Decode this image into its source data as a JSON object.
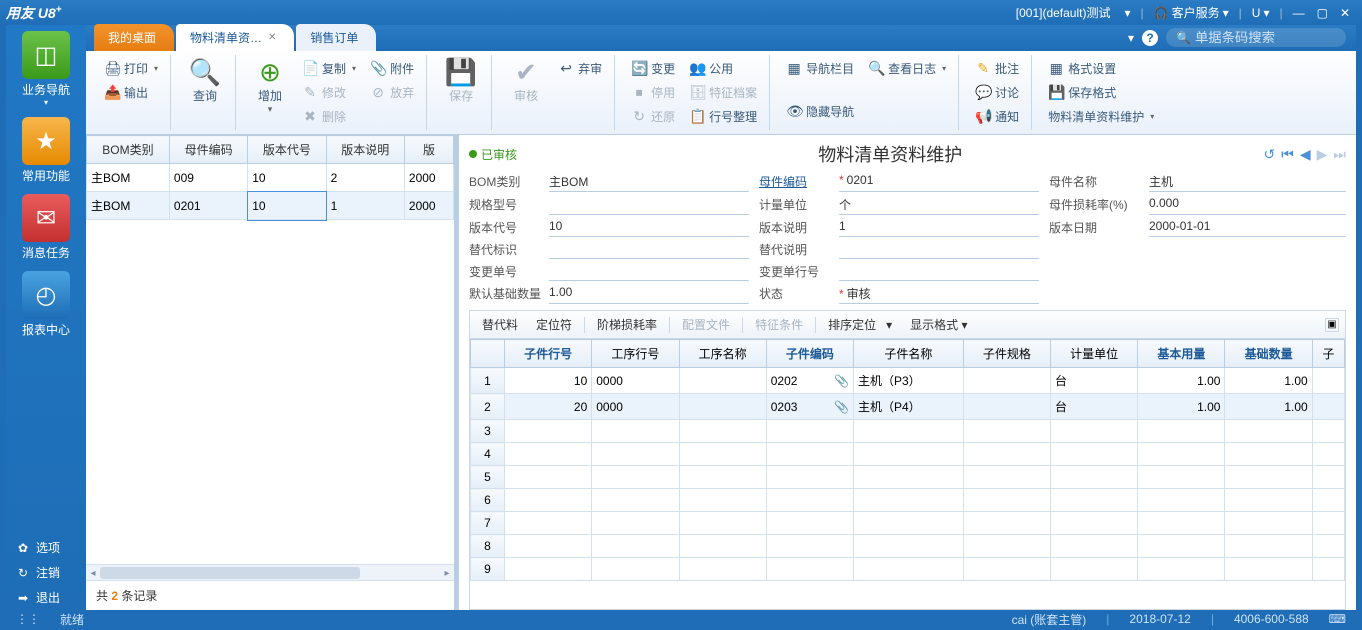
{
  "titlebar": {
    "app_name": "用友 U8",
    "app_sup": "+",
    "account_info": "[001](default)测试",
    "service": "客户服务",
    "u_label": "U"
  },
  "sidebar": {
    "items": [
      {
        "label": "业务导航",
        "icon": "◧"
      },
      {
        "label": "常用功能",
        "icon": "★"
      },
      {
        "label": "消息任务",
        "icon": "✉"
      },
      {
        "label": "报表中心",
        "icon": "◔"
      }
    ],
    "footer": [
      {
        "label": "选项",
        "icon": "✿"
      },
      {
        "label": "注销",
        "icon": "⟳"
      },
      {
        "label": "退出",
        "icon": "➜"
      }
    ]
  },
  "tabs": {
    "items": [
      {
        "label": "我的桌面"
      },
      {
        "label": "物料清单资…"
      },
      {
        "label": "销售订单"
      }
    ],
    "search_placeholder": "单据条码搜索"
  },
  "ribbon": {
    "print": "打印",
    "export": "输出",
    "query": "查询",
    "add": "增加",
    "copy": "复制",
    "modify": "修改",
    "delete": "删除",
    "attach": "附件",
    "abandon": "放弃",
    "save": "保存",
    "audit": "审核",
    "unaudit": "弃审",
    "change": "变更",
    "stop": "停用",
    "restore": "还原",
    "public": "公用",
    "spec_archive": "特征档案",
    "line_arrange": "行号整理",
    "navbar": "导航栏目",
    "viewlog": "查看日志",
    "hidenav": "隐藏导航",
    "annotate": "批注",
    "discuss": "讨论",
    "notify": "通知",
    "format_set": "格式设置",
    "save_format": "保存格式",
    "bom_maint": "物料清单资料维护"
  },
  "list": {
    "headers": [
      "BOM类别",
      "母件编码",
      "版本代号",
      "版本说明",
      "版"
    ],
    "rows": [
      {
        "c": [
          "主BOM",
          "009",
          "10",
          "2",
          "2000"
        ]
      },
      {
        "c": [
          "主BOM",
          "0201",
          "10",
          "1",
          "2000"
        ]
      }
    ],
    "footer_prefix": "共",
    "footer_count": "2",
    "footer_suffix": "条记录"
  },
  "detail": {
    "status": "已审核",
    "title": "物料清单资料维护",
    "fields": {
      "bom_type_lbl": "BOM类别",
      "bom_type": "主BOM",
      "parent_code_lbl": "母件编码",
      "parent_code": "0201",
      "parent_name_lbl": "母件名称",
      "parent_name": "主机",
      "spec_lbl": "规格型号",
      "spec": "",
      "unit_lbl": "计量单位",
      "unit": "个",
      "loss_rate_lbl": "母件损耗率(%)",
      "loss_rate": "0.000",
      "ver_code_lbl": "版本代号",
      "ver_code": "10",
      "ver_desc_lbl": "版本说明",
      "ver_desc": "1",
      "ver_date_lbl": "版本日期",
      "ver_date": "2000-01-01",
      "sub_flag_lbl": "替代标识",
      "sub_desc_lbl": "替代说明",
      "change_no_lbl": "变更单号",
      "change_line_lbl": "变更单行号",
      "default_qty_lbl": "默认基础数量",
      "default_qty": "1.00",
      "state_lbl": "状态",
      "state": "审核"
    },
    "subtoolbar": {
      "sub": "替代料",
      "pos": "定位符",
      "step_loss": "阶梯损耗率",
      "config": "配置文件",
      "feature": "特征条件",
      "sort": "排序定位",
      "display": "显示格式"
    },
    "columns": [
      "",
      "子件行号",
      "工序行号",
      "工序名称",
      "子件编码",
      "子件名称",
      "子件规格",
      "计量单位",
      "基本用量",
      "基础数量",
      "子"
    ],
    "key_cols": [
      1,
      4,
      8,
      9
    ],
    "rows": [
      {
        "line": "10",
        "op": "0000",
        "opname": "",
        "code": "0202",
        "name": "主机（P3）",
        "spec": "",
        "unit": "台",
        "qty1": "1.00",
        "qty2": "1.00"
      },
      {
        "line": "20",
        "op": "0000",
        "opname": "",
        "code": "0203",
        "name": "主机（P4）",
        "spec": "",
        "unit": "台",
        "qty1": "1.00",
        "qty2": "1.00"
      }
    ],
    "total_rows": 9
  },
  "statusbar": {
    "ready": "就绪",
    "user": "cai (账套主管)",
    "date": "2018-07-12",
    "phone": "4006-600-588"
  }
}
